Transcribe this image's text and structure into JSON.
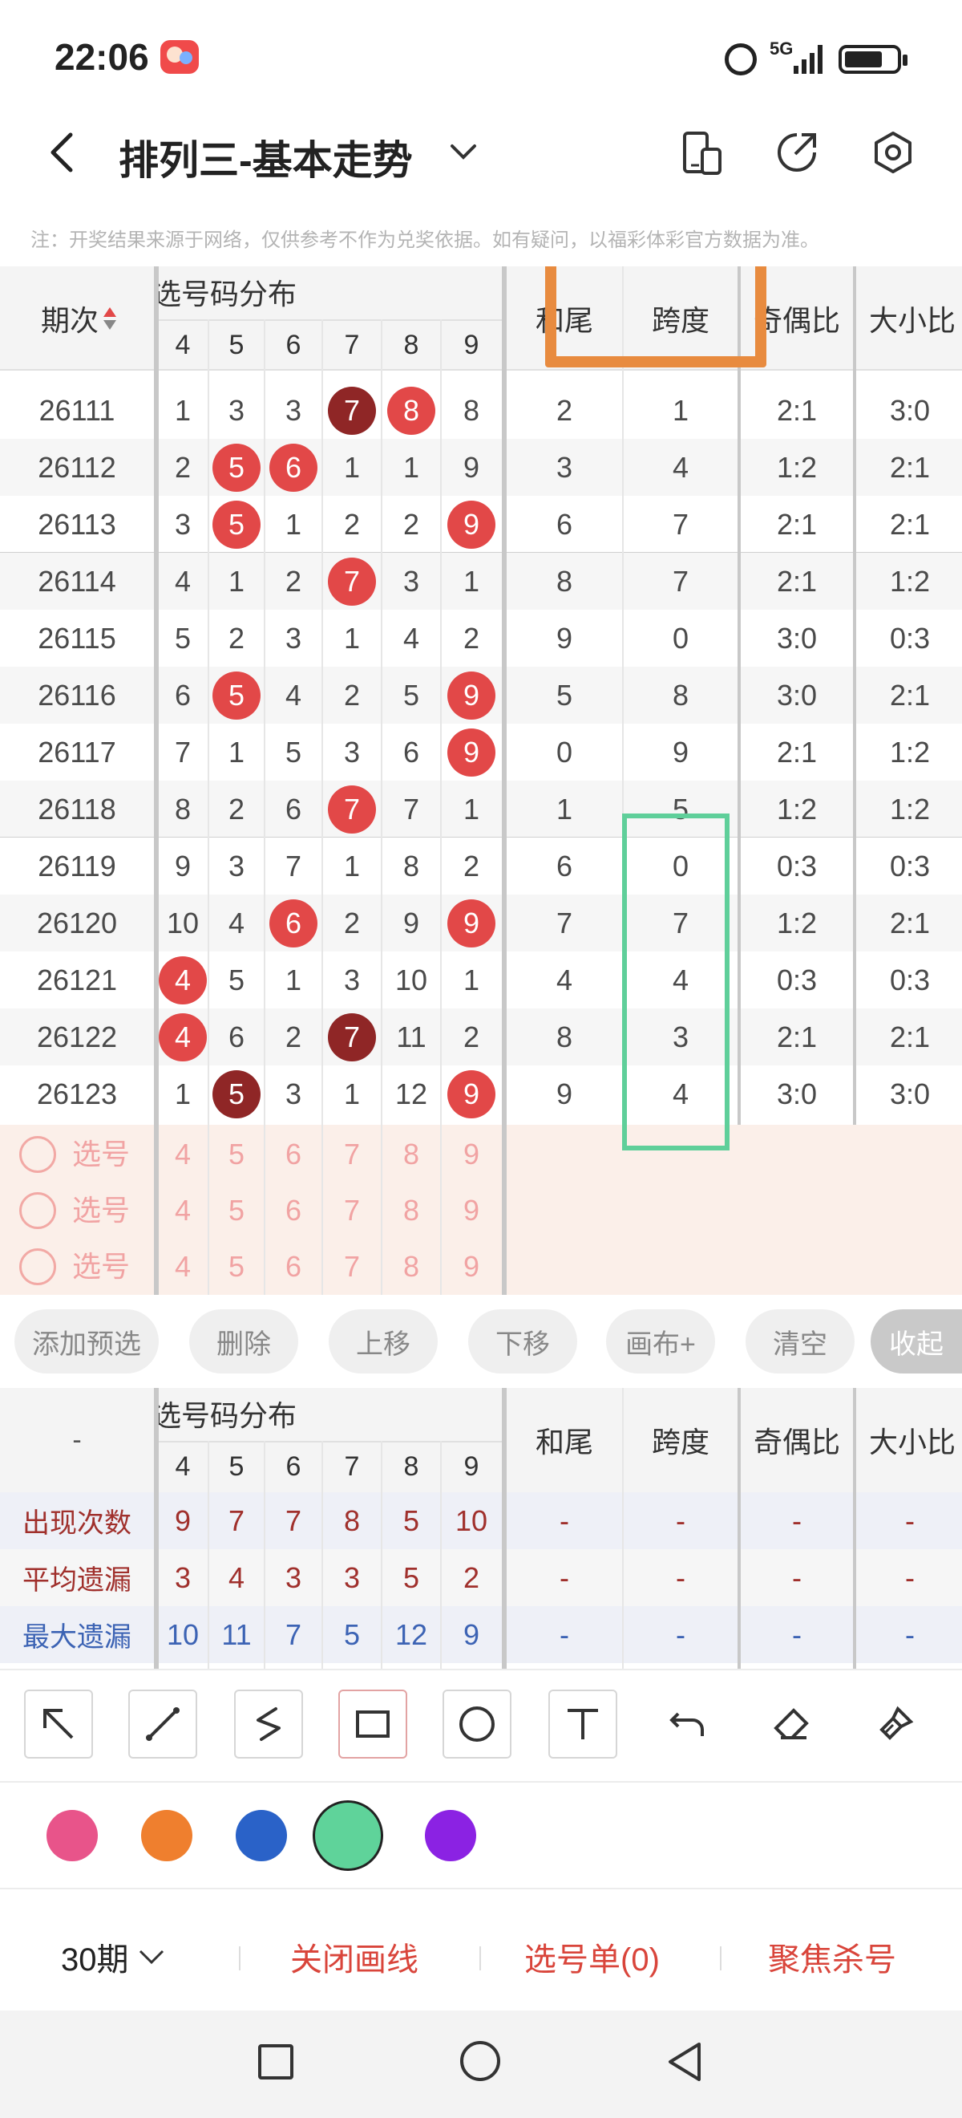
{
  "status_bar": {
    "time": "22:06",
    "network": "5G"
  },
  "nav": {
    "title": "排列三-基本走势"
  },
  "notice": "注：开奖结果来源于网络，仅供参考不作为兑奖依据。如有疑问，以福彩体彩官方数据为准。",
  "table": {
    "header": {
      "period": "期次",
      "distribution": "选号码分布",
      "digits": [
        "4",
        "5",
        "6",
        "7",
        "8",
        "9"
      ],
      "sum_tail": "和尾",
      "span": "跨度",
      "odd_even": "奇偶比",
      "big_small": "大小比"
    },
    "rows": [
      {
        "period": "26111",
        "nums": [
          "1",
          "3",
          "3",
          "7",
          "8",
          "8"
        ],
        "balls": [
          "",
          "",
          "",
          "dark",
          "red",
          ""
        ],
        "sum_tail": "2",
        "span": "1",
        "odd_even": "2:1",
        "big_small": "3:0"
      },
      {
        "period": "26112",
        "nums": [
          "2",
          "5",
          "6",
          "1",
          "1",
          "9"
        ],
        "balls": [
          "",
          "red",
          "red",
          "",
          "",
          ""
        ],
        "sum_tail": "3",
        "span": "4",
        "odd_even": "1:2",
        "big_small": "2:1"
      },
      {
        "period": "26113",
        "nums": [
          "3",
          "5",
          "1",
          "2",
          "2",
          "9"
        ],
        "balls": [
          "",
          "red",
          "",
          "",
          "",
          "red"
        ],
        "sum_tail": "6",
        "span": "7",
        "odd_even": "2:1",
        "big_small": "2:1"
      },
      {
        "period": "26114",
        "nums": [
          "4",
          "1",
          "2",
          "7",
          "3",
          "1"
        ],
        "balls": [
          "",
          "",
          "",
          "red",
          "",
          ""
        ],
        "sum_tail": "8",
        "span": "7",
        "odd_even": "2:1",
        "big_small": "1:2"
      },
      {
        "period": "26115",
        "nums": [
          "5",
          "2",
          "3",
          "1",
          "4",
          "2"
        ],
        "balls": [
          "",
          "",
          "",
          "",
          "",
          ""
        ],
        "sum_tail": "9",
        "span": "0",
        "odd_even": "3:0",
        "big_small": "0:3"
      },
      {
        "period": "26116",
        "nums": [
          "6",
          "5",
          "4",
          "2",
          "5",
          "9"
        ],
        "balls": [
          "",
          "red",
          "",
          "",
          "",
          "red"
        ],
        "sum_tail": "5",
        "span": "8",
        "odd_even": "3:0",
        "big_small": "2:1"
      },
      {
        "period": "26117",
        "nums": [
          "7",
          "1",
          "5",
          "3",
          "6",
          "9"
        ],
        "balls": [
          "",
          "",
          "",
          "",
          "",
          "red"
        ],
        "sum_tail": "0",
        "span": "9",
        "odd_even": "2:1",
        "big_small": "1:2"
      },
      {
        "period": "26118",
        "nums": [
          "8",
          "2",
          "6",
          "7",
          "7",
          "1"
        ],
        "balls": [
          "",
          "",
          "",
          "red",
          "",
          ""
        ],
        "sum_tail": "1",
        "span": "5",
        "odd_even": "1:2",
        "big_small": "1:2"
      },
      {
        "period": "26119",
        "nums": [
          "9",
          "3",
          "7",
          "1",
          "8",
          "2"
        ],
        "balls": [
          "",
          "",
          "",
          "",
          "",
          ""
        ],
        "sum_tail": "6",
        "span": "0",
        "odd_even": "0:3",
        "big_small": "0:3"
      },
      {
        "period": "26120",
        "nums": [
          "10",
          "4",
          "6",
          "2",
          "9",
          "9"
        ],
        "balls": [
          "",
          "",
          "red",
          "",
          "",
          "red"
        ],
        "sum_tail": "7",
        "span": "7",
        "odd_even": "1:2",
        "big_small": "2:1"
      },
      {
        "period": "26121",
        "nums": [
          "4",
          "5",
          "1",
          "3",
          "10",
          "1"
        ],
        "balls": [
          "red",
          "",
          "",
          "",
          "",
          ""
        ],
        "sum_tail": "4",
        "span": "4",
        "odd_even": "0:3",
        "big_small": "0:3"
      },
      {
        "period": "26122",
        "nums": [
          "4",
          "6",
          "2",
          "7",
          "11",
          "2"
        ],
        "balls": [
          "red",
          "",
          "",
          "dark",
          "",
          ""
        ],
        "sum_tail": "8",
        "span": "3",
        "odd_even": "2:1",
        "big_small": "2:1"
      },
      {
        "period": "26123",
        "nums": [
          "1",
          "5",
          "3",
          "1",
          "12",
          "9"
        ],
        "balls": [
          "",
          "dark",
          "",
          "",
          "",
          "red"
        ],
        "sum_tail": "9",
        "span": "4",
        "odd_even": "3:0",
        "big_small": "3:0"
      }
    ],
    "pick_label": "选号",
    "pick_digits": [
      "4",
      "5",
      "6",
      "7",
      "8",
      "9"
    ]
  },
  "buttons": [
    "添加预选",
    "删除",
    "上移",
    "下移",
    "画布+",
    "清空",
    "收起"
  ],
  "stats": {
    "dash": "-",
    "header": {
      "distribution": "选号码分布",
      "digits": [
        "4",
        "5",
        "6",
        "7",
        "8",
        "9"
      ],
      "sum_tail": "和尾",
      "span": "跨度",
      "odd_even": "奇偶比",
      "big_small": "大小比"
    },
    "rows": [
      {
        "label": "出现次数",
        "values": [
          "9",
          "7",
          "7",
          "8",
          "5",
          "10"
        ],
        "rest": [
          "-",
          "-",
          "-",
          "-"
        ],
        "color": "#a0302c"
      },
      {
        "label": "平均遗漏",
        "values": [
          "3",
          "4",
          "3",
          "3",
          "5",
          "2"
        ],
        "rest": [
          "-",
          "-",
          "-",
          "-"
        ],
        "color": "#a0302c"
      },
      {
        "label": "最大遗漏",
        "values": [
          "10",
          "11",
          "7",
          "5",
          "12",
          "9"
        ],
        "rest": [
          "-",
          "-",
          "-",
          "-"
        ],
        "color": "#3c63b4"
      }
    ]
  },
  "tool_icons": [
    "arrow-tool-icon",
    "line-tool-icon",
    "freehand-tool-icon",
    "rectangle-tool-icon",
    "circle-tool-icon",
    "text-tool-icon",
    "undo-icon",
    "eraser-icon",
    "clear-brush-icon"
  ],
  "colors": [
    "#e8548a",
    "#ef7f2e",
    "#2a62c8",
    "#5fd39a",
    "#8b22e3"
  ],
  "bottom": {
    "period_select": "30期",
    "close_draw": "关闭画线",
    "pick_list": "选号单(0)",
    "focus_kill": "聚焦杀号"
  }
}
